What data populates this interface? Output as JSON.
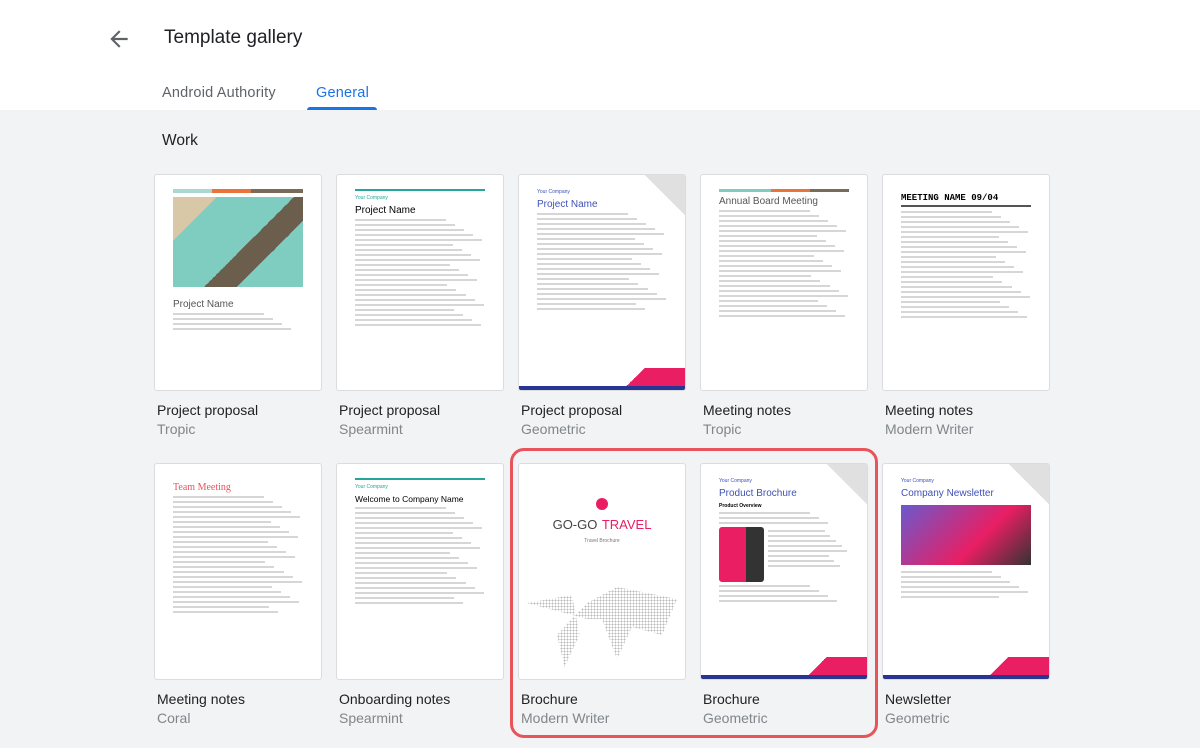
{
  "header": {
    "title": "Template gallery",
    "back_icon": "arrow-left-icon"
  },
  "tabs": [
    {
      "label": "Android Authority",
      "active": false
    },
    {
      "label": "General",
      "active": true
    }
  ],
  "section": "Work",
  "accent": "#1a73e8",
  "highlight_color": "#e8545c",
  "templates": [
    {
      "name": "Project proposal",
      "style": "Tropic",
      "thumb": {
        "heading": "Project Name"
      }
    },
    {
      "name": "Project proposal",
      "style": "Spearmint",
      "thumb": {
        "company": "Your Company",
        "heading": "Project Name"
      }
    },
    {
      "name": "Project proposal",
      "style": "Geometric",
      "thumb": {
        "company": "Your Company",
        "heading": "Project Name"
      }
    },
    {
      "name": "Meeting notes",
      "style": "Tropic",
      "thumb": {
        "heading": "Annual Board Meeting"
      }
    },
    {
      "name": "Meeting notes",
      "style": "Modern Writer",
      "thumb": {
        "heading": "MEETING NAME 09/04"
      }
    },
    {
      "name": "Meeting notes",
      "style": "Coral",
      "thumb": {
        "heading": "Team Meeting"
      }
    },
    {
      "name": "Onboarding notes",
      "style": "Spearmint",
      "thumb": {
        "company": "Your Company",
        "heading": "Welcome to Company Name"
      }
    },
    {
      "name": "Brochure",
      "style": "Modern Writer",
      "thumb": {
        "heading": "GO-GO",
        "heading2": "TRAVEL",
        "sub": "Travel Brochure"
      }
    },
    {
      "name": "Brochure",
      "style": "Geometric",
      "thumb": {
        "company": "Your Company",
        "heading": "Product Brochure",
        "sub": "Product Overview"
      }
    },
    {
      "name": "Newsletter",
      "style": "Geometric",
      "thumb": {
        "company": "Your Company",
        "heading": "Company Newsletter"
      }
    }
  ]
}
